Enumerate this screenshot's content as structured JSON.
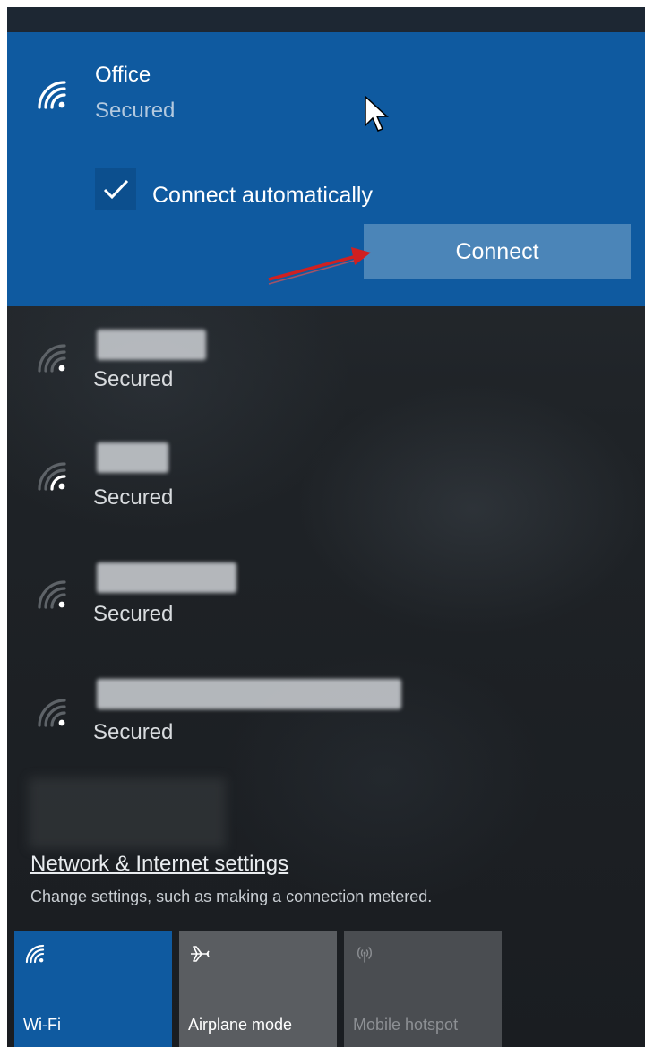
{
  "selected_network": {
    "name": "Office",
    "status": "Secured",
    "auto_connect_label": "Connect automatically",
    "auto_connect_checked": true,
    "connect_label": "Connect",
    "icon": "wifi-icon"
  },
  "networks": [
    {
      "status": "Secured",
      "icon": "wifi-icon"
    },
    {
      "status": "Secured",
      "icon": "wifi-icon"
    },
    {
      "status": "Secured",
      "icon": "wifi-icon"
    },
    {
      "status": "Secured",
      "icon": "wifi-icon"
    }
  ],
  "settings": {
    "link_label": "Network & Internet settings",
    "description": "Change settings, such as making a connection metered."
  },
  "quick_actions": [
    {
      "label": "Wi-Fi",
      "icon": "wifi-icon",
      "active": true
    },
    {
      "label": "Airplane mode",
      "icon": "airplane-icon",
      "active": false
    },
    {
      "label": "Mobile hotspot",
      "icon": "hotspot-icon",
      "active": false,
      "disabled": true
    }
  ],
  "colors": {
    "accent": "#0f5aa0",
    "connect_button": "#4b85b8",
    "tile_inactive": "#5a5d61",
    "annotation_arrow": "#d02020"
  }
}
